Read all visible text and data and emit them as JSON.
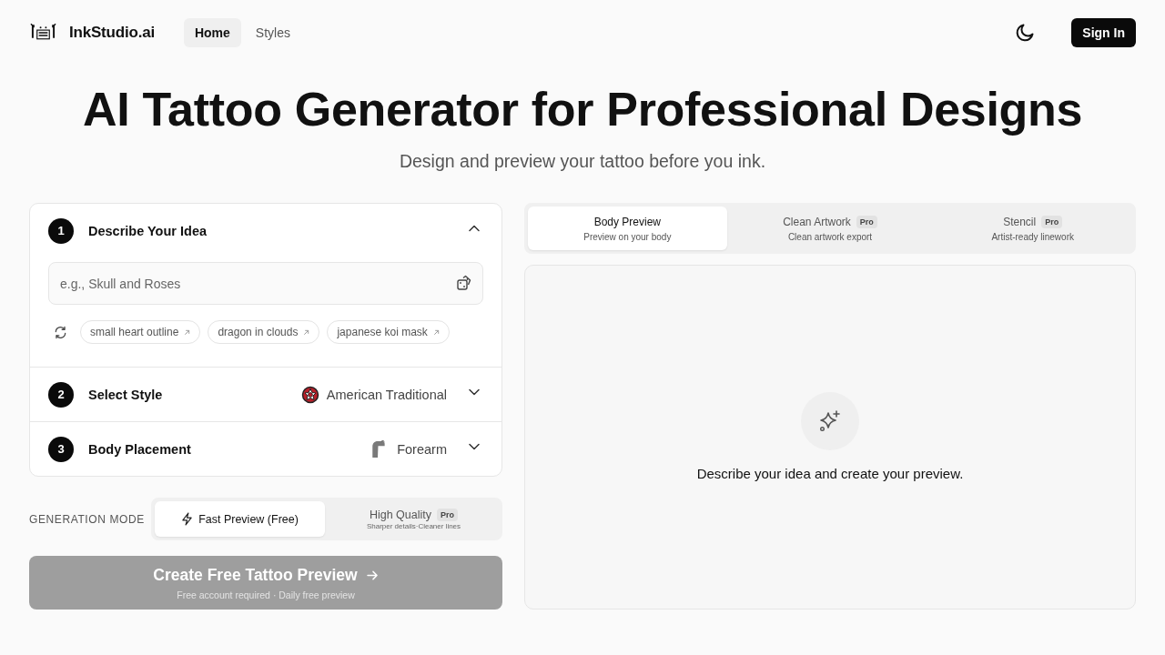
{
  "header": {
    "brand": "InkStudio.ai",
    "nav": [
      {
        "label": "Home",
        "selected": true
      },
      {
        "label": "Styles",
        "selected": false
      }
    ],
    "sign_in": "Sign In"
  },
  "hero": {
    "title": "AI Tattoo Generator for Professional Designs",
    "subtitle": "Design and preview your tattoo before you ink."
  },
  "steps": [
    {
      "number": "1",
      "title": "Describe Your Idea",
      "expanded": true,
      "placeholder": "e.g., Skull and Roses",
      "suggestions": [
        "small heart outline",
        "dragon in clouds",
        "japanese koi mask"
      ]
    },
    {
      "number": "2",
      "title": "Select Style",
      "value": "American Traditional",
      "kind": "style",
      "expanded": false
    },
    {
      "number": "3",
      "title": "Body Placement",
      "value": "Forearm",
      "kind": "placement",
      "expanded": false
    }
  ],
  "generation_mode": {
    "label": "GENERATION MODE",
    "options": [
      {
        "kind": "fast",
        "label": "Fast Preview (Free)",
        "selected": true
      },
      {
        "kind": "quality",
        "label": "High Quality",
        "badge": "Pro",
        "caption": "Sharper details·Cleaner lines",
        "selected": false
      }
    ]
  },
  "create_button": {
    "label": "Create Free Tattoo Preview",
    "caption": "Free account required · Daily free preview",
    "disabled": true
  },
  "preview": {
    "tabs": [
      {
        "label": "Body Preview",
        "caption": "Preview on your body",
        "selected": true
      },
      {
        "label": "Clean Artwork",
        "badge": "Pro",
        "caption": "Clean artwork export",
        "selected": false
      },
      {
        "label": "Stencil",
        "badge": "Pro",
        "caption": "Artist-ready linework",
        "selected": false
      }
    ],
    "empty_message": "Describe your idea and create your preview."
  }
}
